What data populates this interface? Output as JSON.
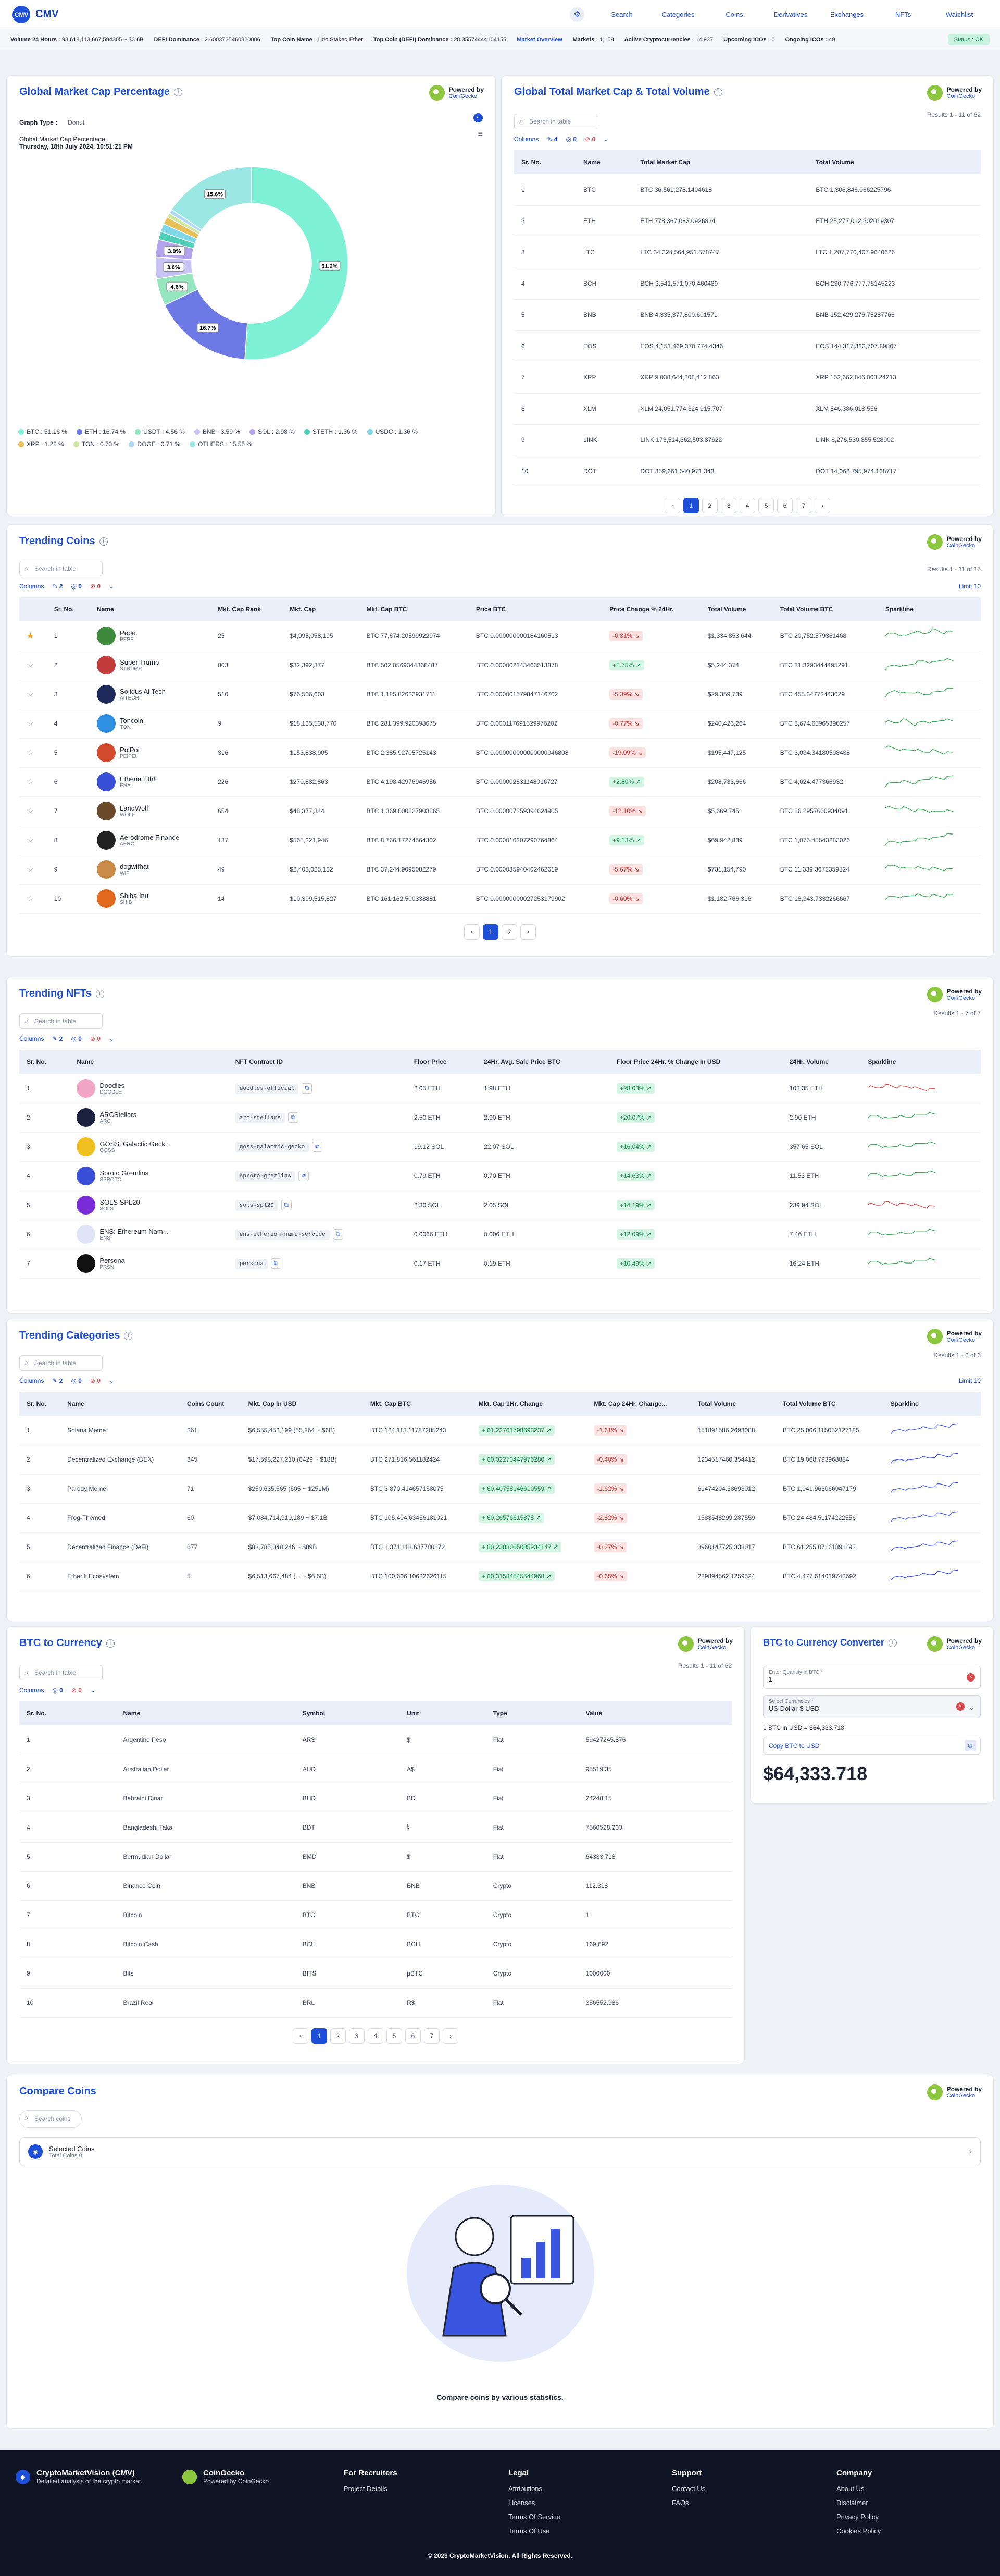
{
  "nav": {
    "brand": "CMV",
    "brand_mark": "CMV",
    "links": [
      "Search",
      "Categories",
      "Coins",
      "Derivatives",
      "Exchanges",
      "NFTs",
      "Watchlist"
    ]
  },
  "ticker": {
    "items": [
      {
        "k": "Volume 24 Hours :",
        "v": "93,618,113,667,594305 ~ $3.6B"
      },
      {
        "k": "DEFI Dominance :",
        "v": "2.6003735460820006"
      },
      {
        "k": "Top Coin Name :",
        "v": "Lido Staked Ether"
      },
      {
        "k": "Top Coin (DEFI) Dominance :",
        "v": "28.35574444104155"
      },
      {
        "k": "Market Overview",
        "v": ""
      },
      {
        "k": "Markets :",
        "v": "1,158"
      },
      {
        "k": "Active Cryptocurrencies :",
        "v": "14,937"
      },
      {
        "k": "Upcoming ICOs :",
        "v": "0"
      },
      {
        "k": "Ongoing ICOs :",
        "v": "49"
      }
    ],
    "status": "Status : OK"
  },
  "powered": {
    "label": "Powered by",
    "name": "CoinGecko"
  },
  "gmcp": {
    "title": "Global Market Cap Percentage",
    "graph_type_label": "Graph Type :",
    "graph_type": "Donut",
    "chart_title": "Global Market Cap Percentage",
    "chart_date": "Thursday, 18th July 2024, 10:51:21 PM"
  },
  "chart_data": {
    "type": "pie",
    "title": "Global Market Cap Percentage",
    "subtitle": "Thursday, 18th July 2024, 10:51:21 PM",
    "donut": true,
    "categories": [
      "BTC",
      "ETH",
      "USDT",
      "BNB",
      "SOL",
      "STETH",
      "USDC",
      "XRP",
      "TON",
      "DOGE",
      "OTHERS"
    ],
    "values": [
      51.16,
      16.74,
      4.56,
      3.59,
      2.98,
      1.36,
      1.36,
      1.28,
      0.73,
      0.71,
      15.6
    ],
    "slice_labels": [
      "51.2%",
      "16.7%",
      "4.6%",
      "3.6%",
      "3.0%",
      "",
      "",
      "",
      "",
      "",
      "15.6%"
    ],
    "colors": [
      "#7ef0d6",
      "#6d79e5",
      "#95e6bf",
      "#c8c3f5",
      "#b3a3ec",
      "#4fcfb9",
      "#7fd8e8",
      "#e6c15a",
      "#cde7a0",
      "#aed8f7",
      "#9be7e3"
    ],
    "legend_labels": [
      "BTC : 51.16 %",
      "ETH : 16.74 %",
      "USDT : 4.56 %",
      "BNB : 3.59 %",
      "SOL : 2.98 %",
      "STETH : 1.36 %",
      "USDC : 1.36 %",
      "XRP : 1.28 %",
      "TON : 0.73 %",
      "DOGE : 0.71 %",
      "OTHERS : 15.55 %"
    ]
  },
  "gtm": {
    "title": "Global Total Market Cap & Total Volume",
    "search": "Search in table",
    "results": "Results 1 - 11 of 62",
    "filters": {
      "label": "Columns",
      "p": "4",
      "n": "0",
      "r": "0"
    },
    "headers": [
      "Sr. No.",
      "Name",
      "Total Market Cap",
      "Total Volume"
    ],
    "rows": [
      [
        "1",
        "BTC",
        "BTC 36,561,278.1404618",
        "BTC 1,306,846.066225796"
      ],
      [
        "2",
        "ETH",
        "ETH 778,367,083.0926824",
        "ETH 25,277,012.202019307"
      ],
      [
        "3",
        "LTC",
        "LTC 34,324,564,951.578747",
        "LTC 1,207,770,407.9640626"
      ],
      [
        "4",
        "BCH",
        "BCH 3,541,571,070.460489",
        "BCH 230,776,777.75145223"
      ],
      [
        "5",
        "BNB",
        "BNB 4,335,377,800.601571",
        "BNB 152,429,276.75287766"
      ],
      [
        "6",
        "EOS",
        "EOS 4,151,469,370,774.4346",
        "EOS 144,317,332,707.89807"
      ],
      [
        "7",
        "XRP",
        "XRP 9,038,644,208,412.863",
        "XRP 152,662,846,063.24213"
      ],
      [
        "8",
        "XLM",
        "XLM 24,051,774,324,915.707",
        "XLM 846,386,018,556"
      ],
      [
        "9",
        "LINK",
        "LINK 173,514,362,503.87622",
        "LINK 6,276,530,855.528902"
      ],
      [
        "10",
        "DOT",
        "DOT 359,661,540,971.343",
        "DOT 14,062,795,974.168717"
      ]
    ],
    "pages": [
      "‹",
      "1",
      "2",
      "3",
      "4",
      "5",
      "6",
      "7",
      "›"
    ]
  },
  "trending": {
    "title": "Trending Coins",
    "search": "Search in table",
    "results": "Results 1 - 11 of 15",
    "limit": "Limit 10",
    "filters": {
      "label": "Columns",
      "p": "2",
      "n": "0",
      "r": "0"
    },
    "headers": [
      "",
      "Sr. No.",
      "Name",
      "Mkt. Cap Rank",
      "Mkt. Cap",
      "Mkt. Cap BTC",
      "Price BTC",
      "Price Change % 24Hr.",
      "Total Volume",
      "Total Volume BTC",
      "Sparkline"
    ],
    "rows": [
      {
        "star": true,
        "no": "1",
        "name": "Pepe",
        "sym": "PEPE",
        "rank": "25",
        "cap": "$4,995,058,195",
        "capbtc": "BTC 77,674.20599922974",
        "price": "BTC 0.000000000184160513",
        "chg": "-6.81% ↘",
        "up": false,
        "vol": "$1,334,853,644",
        "volbtc": "BTC 20,752.579361468",
        "c": "#3e8a3c",
        "trend": [
          0.5,
          0.6,
          0.4,
          0.7,
          0.55,
          0.8,
          0.6,
          0.7
        ]
      },
      {
        "star": false,
        "no": "2",
        "name": "Super Trump",
        "sym": "STRUMP",
        "rank": "803",
        "cap": "$32,392,377",
        "capbtc": "BTC 502.0569344368487",
        "price": "BTC 0.000002143463513878",
        "chg": "+5.75% ↗",
        "up": true,
        "vol": "$5,244,374",
        "volbtc": "BTC 81.3293444495291",
        "c": "#c23a3a",
        "trend": [
          0.3,
          0.5,
          0.4,
          0.6,
          0.7,
          0.6,
          0.8,
          0.7
        ]
      },
      {
        "star": false,
        "no": "3",
        "name": "Solidus Ai Tech",
        "sym": "AITECH",
        "rank": "510",
        "cap": "$76,506,603",
        "capbtc": "BTC 1,185.82622931711",
        "price": "BTC 0.000001579847146702",
        "chg": "-5.39% ↘",
        "up": false,
        "vol": "$29,359,739",
        "volbtc": "BTC 455.34772443029",
        "c": "#1f2a5c",
        "trend": [
          0.4,
          0.7,
          0.5,
          0.6,
          0.45,
          0.55,
          0.7,
          0.8
        ]
      },
      {
        "star": false,
        "no": "4",
        "name": "Toncoin",
        "sym": "TON",
        "rank": "9",
        "cap": "$18,135,538,770",
        "capbtc": "BTC 281,399.920398675",
        "price": "BTC 0.000117691529976202",
        "chg": "-0.77% ↘",
        "up": false,
        "vol": "$240,426,264",
        "volbtc": "BTC 3,674.65965396257",
        "c": "#2f8fe0",
        "trend": [
          0.6,
          0.5,
          0.7,
          0.4,
          0.6,
          0.5,
          0.7,
          0.6
        ]
      },
      {
        "star": false,
        "no": "5",
        "name": "PolPoi",
        "sym": "PEIPEI",
        "rank": "316",
        "cap": "$153,838,905",
        "capbtc": "BTC 2,385.92705725143",
        "price": "BTC 0.000000000000000046808",
        "chg": "-19.09% ↘",
        "up": false,
        "vol": "$195,447,125",
        "volbtc": "BTC 3,034.34180508438",
        "c": "#d24b2f",
        "trend": [
          0.8,
          0.7,
          0.6,
          0.65,
          0.5,
          0.6,
          0.45,
          0.5
        ]
      },
      {
        "star": false,
        "no": "6",
        "name": "Ethena Ethfi",
        "sym": "ENA",
        "rank": "226",
        "cap": "$270,882,863",
        "capbtc": "BTC 4,198.42976946956",
        "price": "BTC 0.000002631148016727",
        "chg": "+2.80% ↗",
        "up": true,
        "vol": "$208,733,666",
        "volbtc": "BTC 4,624.477366932",
        "c": "#3a4fd8",
        "trend": [
          0.3,
          0.45,
          0.5,
          0.4,
          0.6,
          0.7,
          0.65,
          0.8
        ]
      },
      {
        "star": false,
        "no": "7",
        "name": "LandWolf",
        "sym": "WOLF",
        "rank": "654",
        "cap": "$48,377,344",
        "capbtc": "BTC 1,369.000827903865",
        "price": "BTC 0.000007259394624905",
        "chg": "-12.10% ↘",
        "up": false,
        "vol": "$5,669,745",
        "volbtc": "BTC 86.2957660934091",
        "c": "#6b4a2c",
        "trend": [
          0.7,
          0.6,
          0.65,
          0.5,
          0.55,
          0.4,
          0.5,
          0.45
        ]
      },
      {
        "star": false,
        "no": "8",
        "name": "Aerodrome Finance",
        "sym": "AERO",
        "rank": "137",
        "cap": "$565,221,946",
        "capbtc": "BTC 8,766.17274564302",
        "price": "BTC 0.000016207290764864",
        "chg": "+9.13% ↗",
        "up": true,
        "vol": "$69,942,839",
        "volbtc": "BTC 1,075.45543283026",
        "c": "#222",
        "trend": [
          0.3,
          0.4,
          0.35,
          0.5,
          0.6,
          0.55,
          0.75,
          0.8
        ]
      },
      {
        "star": false,
        "no": "9",
        "name": "dogwifhat",
        "sym": "WIF",
        "rank": "49",
        "cap": "$2,403,025,132",
        "capbtc": "BTC 37,244.9095082279",
        "price": "BTC 0.000035940402462619",
        "chg": "-5.67% ↘",
        "up": false,
        "vol": "$731,154,790",
        "volbtc": "BTC 11,339.3672359824",
        "c": "#c98b4a",
        "trend": [
          0.6,
          0.7,
          0.5,
          0.6,
          0.5,
          0.55,
          0.45,
          0.5
        ]
      },
      {
        "star": false,
        "no": "10",
        "name": "Shiba Inu",
        "sym": "SHIB",
        "rank": "14",
        "cap": "$10,399,515,827",
        "capbtc": "BTC 161,162.500338881",
        "price": "BTC 0.00000000027253179902",
        "chg": "-0.60% ↘",
        "up": false,
        "vol": "$1,182,766,316",
        "volbtc": "BTC 18,343.7332266667",
        "c": "#e26a1e",
        "trend": [
          0.5,
          0.6,
          0.55,
          0.7,
          0.6,
          0.65,
          0.6,
          0.7
        ]
      }
    ],
    "pages": [
      "‹",
      "1",
      "2",
      "›"
    ]
  },
  "nfts": {
    "title": "Trending NFTs",
    "search": "Search in table",
    "results": "Results 1 - 7 of 7",
    "filters": {
      "label": "Columns",
      "p": "2",
      "n": "0",
      "r": "0"
    },
    "headers": [
      "Sr. No.",
      "Name",
      "NFT Contract ID",
      "Floor Price",
      "24Hr. Avg. Sale Price BTC",
      "Floor Price 24Hr. % Change in USD",
      "24Hr. Volume",
      "Sparkline"
    ],
    "rows": [
      {
        "no": "1",
        "name": "Doodles",
        "sym": "DOODLE",
        "contract": "doodles-official",
        "floor": "2.05 ETH",
        "avg": "1.98 ETH",
        "chg": "+28.03% ↗",
        "up": true,
        "vol": "102.35 ETH",
        "c": "#f2a6c6",
        "spark": "#d94848"
      },
      {
        "no": "2",
        "name": "ARCStellars",
        "sym": "ARC",
        "contract": "arc-stellars",
        "floor": "2.50 ETH",
        "avg": "2.90 ETH",
        "chg": "+20.07% ↗",
        "up": true,
        "vol": "2.90 ETH",
        "c": "#1b2240",
        "spark": "#34a853"
      },
      {
        "no": "3",
        "name": "GOSS: Galactic Geck...",
        "sym": "GOSS",
        "contract": "goss-galactic-gecko",
        "floor": "19.12 SOL",
        "avg": "22.07 SOL",
        "chg": "+16.04% ↗",
        "up": true,
        "vol": "357.65 SOL",
        "c": "#f0c020",
        "spark": "#34a853"
      },
      {
        "no": "4",
        "name": "Sproto Gremlins",
        "sym": "SPROTO",
        "contract": "sproto-gremlins",
        "floor": "0.79 ETH",
        "avg": "0.70 ETH",
        "chg": "+14.63% ↗",
        "up": true,
        "vol": "11.53 ETH",
        "c": "#3a4fd8",
        "spark": "#34a853"
      },
      {
        "no": "5",
        "name": "SOLS SPL20",
        "sym": "SOLS",
        "contract": "sols-spl20",
        "floor": "2.30 SOL",
        "avg": "2.05 SOL",
        "chg": "+14.19% ↗",
        "up": true,
        "vol": "239.94 SOL",
        "c": "#7a2bd8",
        "spark": "#d94848"
      },
      {
        "no": "6",
        "name": "ENS: Ethereum Nam...",
        "sym": "ENS",
        "contract": "ens-ethereum-name-service",
        "floor": "0.0066 ETH",
        "avg": "0.006 ETH",
        "chg": "+12.09% ↗",
        "up": true,
        "vol": "7.46 ETH",
        "c": "#dfe4f6",
        "spark": "#34a853"
      },
      {
        "no": "7",
        "name": "Persona",
        "sym": "PRSN",
        "contract": "persona",
        "floor": "0.17 ETH",
        "avg": "0.19 ETH",
        "chg": "+10.49% ↗",
        "up": true,
        "vol": "16.24 ETH",
        "c": "#111",
        "spark": "#34a853"
      }
    ]
  },
  "cats": {
    "title": "Trending Categories",
    "search": "Search in table",
    "results": "Results 1 - 6 of 6",
    "limit": "Limit 10",
    "filters": {
      "label": "Columns",
      "p": "2",
      "n": "0",
      "r": "0"
    },
    "headers": [
      "Sr. No.",
      "Name",
      "Coins Count",
      "Mkt. Cap in USD",
      "Mkt. Cap BTC",
      "Mkt. Cap 1Hr. Change",
      "Mkt. Cap 24Hr. Change...",
      "Total Volume",
      "Total Volume BTC",
      "Sparkline"
    ],
    "rows": [
      [
        "1",
        "Solana Meme",
        "261",
        "$6,555,452,199 (55,864 ~ $6B)",
        "BTC 124,113.11787285243",
        "+ 61.22761798693237 ↗",
        "-1.61% ↘",
        "151891586.2693088",
        "BTC 25,006.115052127185"
      ],
      [
        "2",
        "Decentralized Exchange (DEX)",
        "345",
        "$17,598,227,210 (6429 ~ $18B)",
        "BTC 271,816.561182424",
        "+ 60.02273447976280 ↗",
        "-0.40% ↘",
        "1234517460.354412",
        "BTC 19,068.793968884"
      ],
      [
        "3",
        "Parody Meme",
        "71",
        "$250,635,565 (605 ~ $251M)",
        "BTC 3,870.414657158075",
        "+ 60.40758146610559 ↗",
        "-1.62% ↘",
        "61474204.38693012",
        "BTC 1,041.963066947179"
      ],
      [
        "4",
        "Frog-Themed",
        "60",
        "$7,084,714,910,189 ~ $7.1B",
        "BTC 105,404.63466181021",
        "+ 60.26576615878 ↗",
        "-2.82% ↘",
        "1583548299.287559",
        "BTC 24,484.51174222556"
      ],
      [
        "5",
        "Decentralized Finance (DeFi)",
        "677",
        "$88,785,348,246 ~ $89B",
        "BTC 1,371,118.637780172",
        "+ 60.2383005005934147 ↗",
        "-0.27% ↘",
        "3960147725.338017",
        "BTC 61,255.07161891192"
      ],
      [
        "6",
        "Ether.fi Ecosystem",
        "5",
        "$6,513,667,484 (... ~ $6.5B)",
        "BTC 100,606.10622626115",
        "+ 60.31584545544968 ↗",
        "-0.65% ↘",
        "289894562.1259524",
        "BTC 4,477.614019742692"
      ]
    ]
  },
  "btcc": {
    "title": "BTC to Currency",
    "search": "Search in table",
    "results": "Results 1 - 11 of 62",
    "filters": {
      "label": "Columns",
      "p": "0",
      "n": "0",
      "r": "0"
    },
    "headers": [
      "Sr. No.",
      "Name",
      "Symbol",
      "Unit",
      "Type",
      "Value"
    ],
    "rows": [
      [
        "1",
        "Argentine Peso",
        "ARS",
        "$",
        "Fiat",
        "59427245.876"
      ],
      [
        "2",
        "Australian Dollar",
        "AUD",
        "A$",
        "Fiat",
        "95519.35"
      ],
      [
        "3",
        "Bahraini Dinar",
        "BHD",
        "BD",
        "Fiat",
        "24248.15"
      ],
      [
        "4",
        "Bangladeshi Taka",
        "BDT",
        "৳",
        "Fiat",
        "7560528.203"
      ],
      [
        "5",
        "Bermudian Dollar",
        "BMD",
        "$",
        "Fiat",
        "64333.718"
      ],
      [
        "6",
        "Binance Coin",
        "BNB",
        "BNB",
        "Crypto",
        "112.318"
      ],
      [
        "7",
        "Bitcoin",
        "BTC",
        "BTC",
        "Crypto",
        "1"
      ],
      [
        "8",
        "Bitcoin Cash",
        "BCH",
        "BCH",
        "Crypto",
        "169.692"
      ],
      [
        "9",
        "Bits",
        "BITS",
        "μBTC",
        "Crypto",
        "1000000"
      ],
      [
        "10",
        "Brazil Real",
        "BRL",
        "R$",
        "Fiat",
        "356552.986"
      ]
    ],
    "pages": [
      "‹",
      "1",
      "2",
      "3",
      "4",
      "5",
      "6",
      "7",
      "›"
    ]
  },
  "conv": {
    "title": "BTC to Currency Converter",
    "qty_label": "Enter Quantity in BTC *",
    "qty": "1",
    "cur_label": "Select Currencies *",
    "cur": "US Dollar $ USD",
    "rate": "1 BTC in USD = $64,333.718",
    "copy": "Copy BTC to USD",
    "result": "$64,333.718"
  },
  "compare": {
    "title": "Compare Coins",
    "search": "Search coins",
    "selected": "Selected Coins",
    "total": "Total Coins 0",
    "caption": "Compare coins by various statistics."
  },
  "footer": {
    "brand1": "CryptoMarketVision (CMV)",
    "brand1_sub": "Detailed analysis of the crypto market.",
    "brand2": "CoinGecko",
    "brand2_sub": "Powered by CoinGecko",
    "cols": [
      {
        "h": "For Recruiters",
        "items": [
          "Project Details"
        ]
      },
      {
        "h": "Legal",
        "items": [
          "Attributions",
          "Licenses",
          "Terms Of Service",
          "Terms Of Use"
        ]
      },
      {
        "h": "Support",
        "items": [
          "Contact Us",
          "FAQs"
        ]
      },
      {
        "h": "Company",
        "items": [
          "About Us",
          "Disclaimer",
          "Privacy Policy",
          "Cookies Policy"
        ]
      }
    ],
    "copyright": "© 2023 CryptoMarketVision. All Rights Reserved."
  }
}
